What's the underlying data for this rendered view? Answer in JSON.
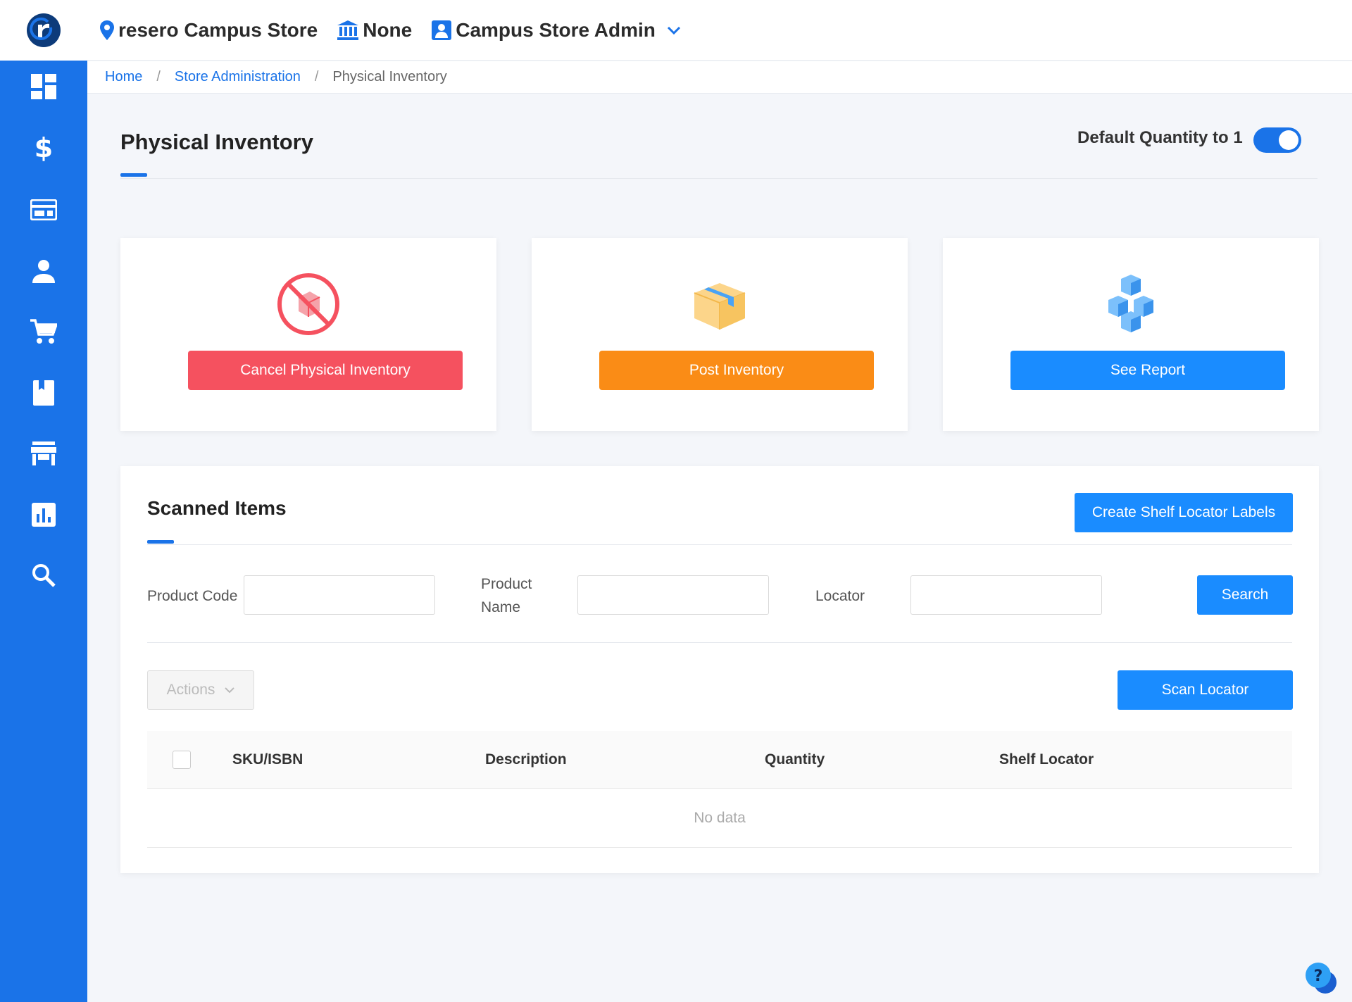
{
  "header": {
    "store_name": "resero Campus Store",
    "institution": "None",
    "user_role": "Campus Store Admin"
  },
  "sidebar": {
    "items": [
      {
        "icon": "dashboard-icon"
      },
      {
        "icon": "dollar-icon"
      },
      {
        "icon": "register-icon"
      },
      {
        "icon": "person-icon"
      },
      {
        "icon": "cart-icon"
      },
      {
        "icon": "book-icon"
      },
      {
        "icon": "store-icon"
      },
      {
        "icon": "chart-icon"
      },
      {
        "icon": "search-icon"
      }
    ]
  },
  "breadcrumb": {
    "home": "Home",
    "section": "Store Administration",
    "current": "Physical Inventory",
    "separator": "/"
  },
  "page": {
    "title": "Physical Inventory",
    "toggle_label": "Default Quantity to 1",
    "toggle_on": true
  },
  "cards": {
    "cancel": {
      "label": "Cancel Physical Inventory",
      "color": "#f5515f"
    },
    "post": {
      "label": "Post Inventory",
      "color": "#fa8c16"
    },
    "report": {
      "label": "See Report",
      "color": "#1a8cff"
    }
  },
  "scanned": {
    "title": "Scanned Items",
    "create_labels_button": "Create Shelf Locator Labels",
    "filters": {
      "product_code_label": "Product Code",
      "product_name_label_line1": "Product",
      "product_name_label_line2": "Name",
      "locator_label": "Locator",
      "product_code_value": "",
      "product_name_value": "",
      "locator_value": ""
    },
    "search_button": "Search",
    "actions_button": "Actions",
    "scan_locator_button": "Scan Locator",
    "columns": [
      "SKU/ISBN",
      "Description",
      "Quantity",
      "Shelf Locator"
    ],
    "empty_text": "No data"
  },
  "colors": {
    "primary": "#1a73e8",
    "button_blue": "#1a8cff"
  }
}
